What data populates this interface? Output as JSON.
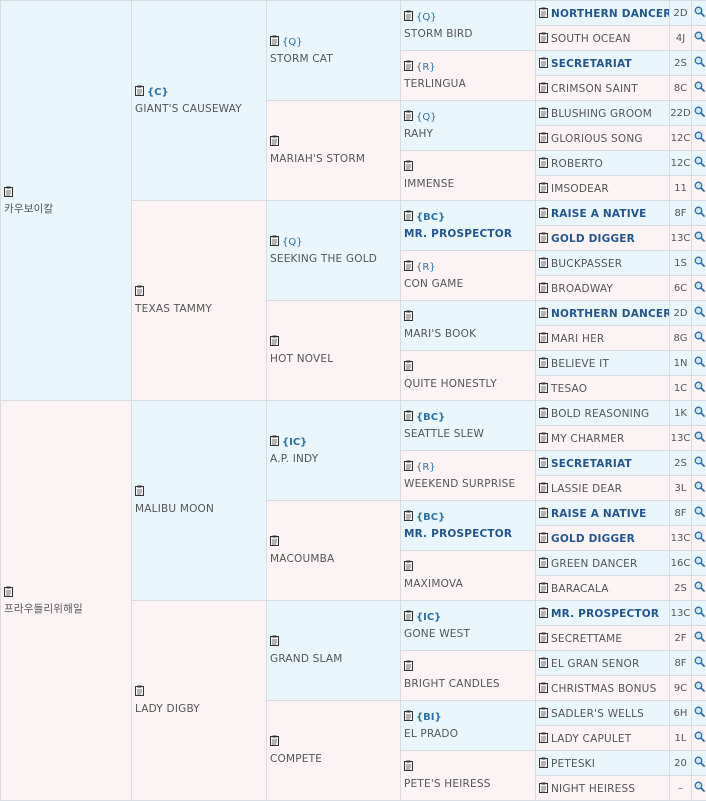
{
  "gen1": [
    {
      "name": "카우보이칼"
    },
    {
      "name": "프라우들리위해일"
    }
  ],
  "gen2": [
    {
      "tag": "{C}",
      "name": "GIANT'S CAUSEWAY"
    },
    {
      "tag": "",
      "name": "TEXAS TAMMY"
    },
    {
      "tag": "",
      "name": "MALIBU MOON"
    },
    {
      "tag": "",
      "name": "LADY DIGBY"
    }
  ],
  "gen3": [
    {
      "tag": "{Q}",
      "name": "STORM CAT"
    },
    {
      "tag": "",
      "name": "MARIAH'S STORM"
    },
    {
      "tag": "{Q}",
      "name": "SEEKING THE GOLD"
    },
    {
      "tag": "",
      "name": "HOT NOVEL"
    },
    {
      "tag": "{IC}",
      "name": "A.P. INDY"
    },
    {
      "tag": "",
      "name": "MACOUMBA"
    },
    {
      "tag": "",
      "name": "GRAND SLAM"
    },
    {
      "tag": "",
      "name": "COMPETE"
    }
  ],
  "gen4": [
    {
      "tag": "{Q}",
      "name": "STORM BIRD"
    },
    {
      "tag": "{R}",
      "name": "TERLINGUA"
    },
    {
      "tag": "{Q}",
      "name": "RAHY"
    },
    {
      "tag": "",
      "name": "IMMENSE"
    },
    {
      "tag": "{BC}",
      "name": "MR. PROSPECTOR"
    },
    {
      "tag": "{R}",
      "name": "CON GAME"
    },
    {
      "tag": "",
      "name": "MARI'S BOOK"
    },
    {
      "tag": "",
      "name": "QUITE HONESTLY"
    },
    {
      "tag": "{BC}",
      "name": "SEATTLE SLEW"
    },
    {
      "tag": "{R}",
      "name": "WEEKEND SURPRISE"
    },
    {
      "tag": "{BC}",
      "name": "MR. PROSPECTOR"
    },
    {
      "tag": "",
      "name": "MAXIMOVA"
    },
    {
      "tag": "{IC}",
      "name": "GONE WEST"
    },
    {
      "tag": "",
      "name": "BRIGHT CANDLES"
    },
    {
      "tag": "{BI}",
      "name": "EL PRADO"
    },
    {
      "tag": "",
      "name": "PETE'S HEIRESS"
    }
  ],
  "gen5": [
    {
      "name": "NORTHERN DANCER",
      "code": "2D"
    },
    {
      "name": "SOUTH OCEAN",
      "code": "4J"
    },
    {
      "name": "SECRETARIAT",
      "code": "2S"
    },
    {
      "name": "CRIMSON SAINT",
      "code": "8C"
    },
    {
      "name": "BLUSHING GROOM",
      "code": "22D"
    },
    {
      "name": "GLORIOUS SONG",
      "code": "12C"
    },
    {
      "name": "ROBERTO",
      "code": "12C"
    },
    {
      "name": "IMSODEAR",
      "code": "11"
    },
    {
      "name": "RAISE A NATIVE",
      "code": "8F"
    },
    {
      "name": "GOLD DIGGER",
      "code": "13C"
    },
    {
      "name": "BUCKPASSER",
      "code": "1S"
    },
    {
      "name": "BROADWAY",
      "code": "6C"
    },
    {
      "name": "NORTHERN DANCER",
      "code": "2D"
    },
    {
      "name": "MARI HER",
      "code": "8G"
    },
    {
      "name": "BELIEVE IT",
      "code": "1N"
    },
    {
      "name": "TESAO",
      "code": "1C"
    },
    {
      "name": "BOLD REASONING",
      "code": "1K"
    },
    {
      "name": "MY CHARMER",
      "code": "13C"
    },
    {
      "name": "SECRETARIAT",
      "code": "2S"
    },
    {
      "name": "LASSIE DEAR",
      "code": "3L"
    },
    {
      "name": "RAISE A NATIVE",
      "code": "8F"
    },
    {
      "name": "GOLD DIGGER",
      "code": "13C"
    },
    {
      "name": "GREEN DANCER",
      "code": "16C"
    },
    {
      "name": "BARACALA",
      "code": "2S"
    },
    {
      "name": "MR. PROSPECTOR",
      "code": "13C"
    },
    {
      "name": "SECRETTAME",
      "code": "2F"
    },
    {
      "name": "EL GRAN SENOR",
      "code": "8F"
    },
    {
      "name": "CHRISTMAS BONUS",
      "code": "9C"
    },
    {
      "name": "SADLER'S WELLS",
      "code": "6H"
    },
    {
      "name": "LADY CAPULET",
      "code": "1L"
    },
    {
      "name": "PETESKI",
      "code": "20"
    },
    {
      "name": "NIGHT HEIRESS",
      "code": "–"
    }
  ]
}
